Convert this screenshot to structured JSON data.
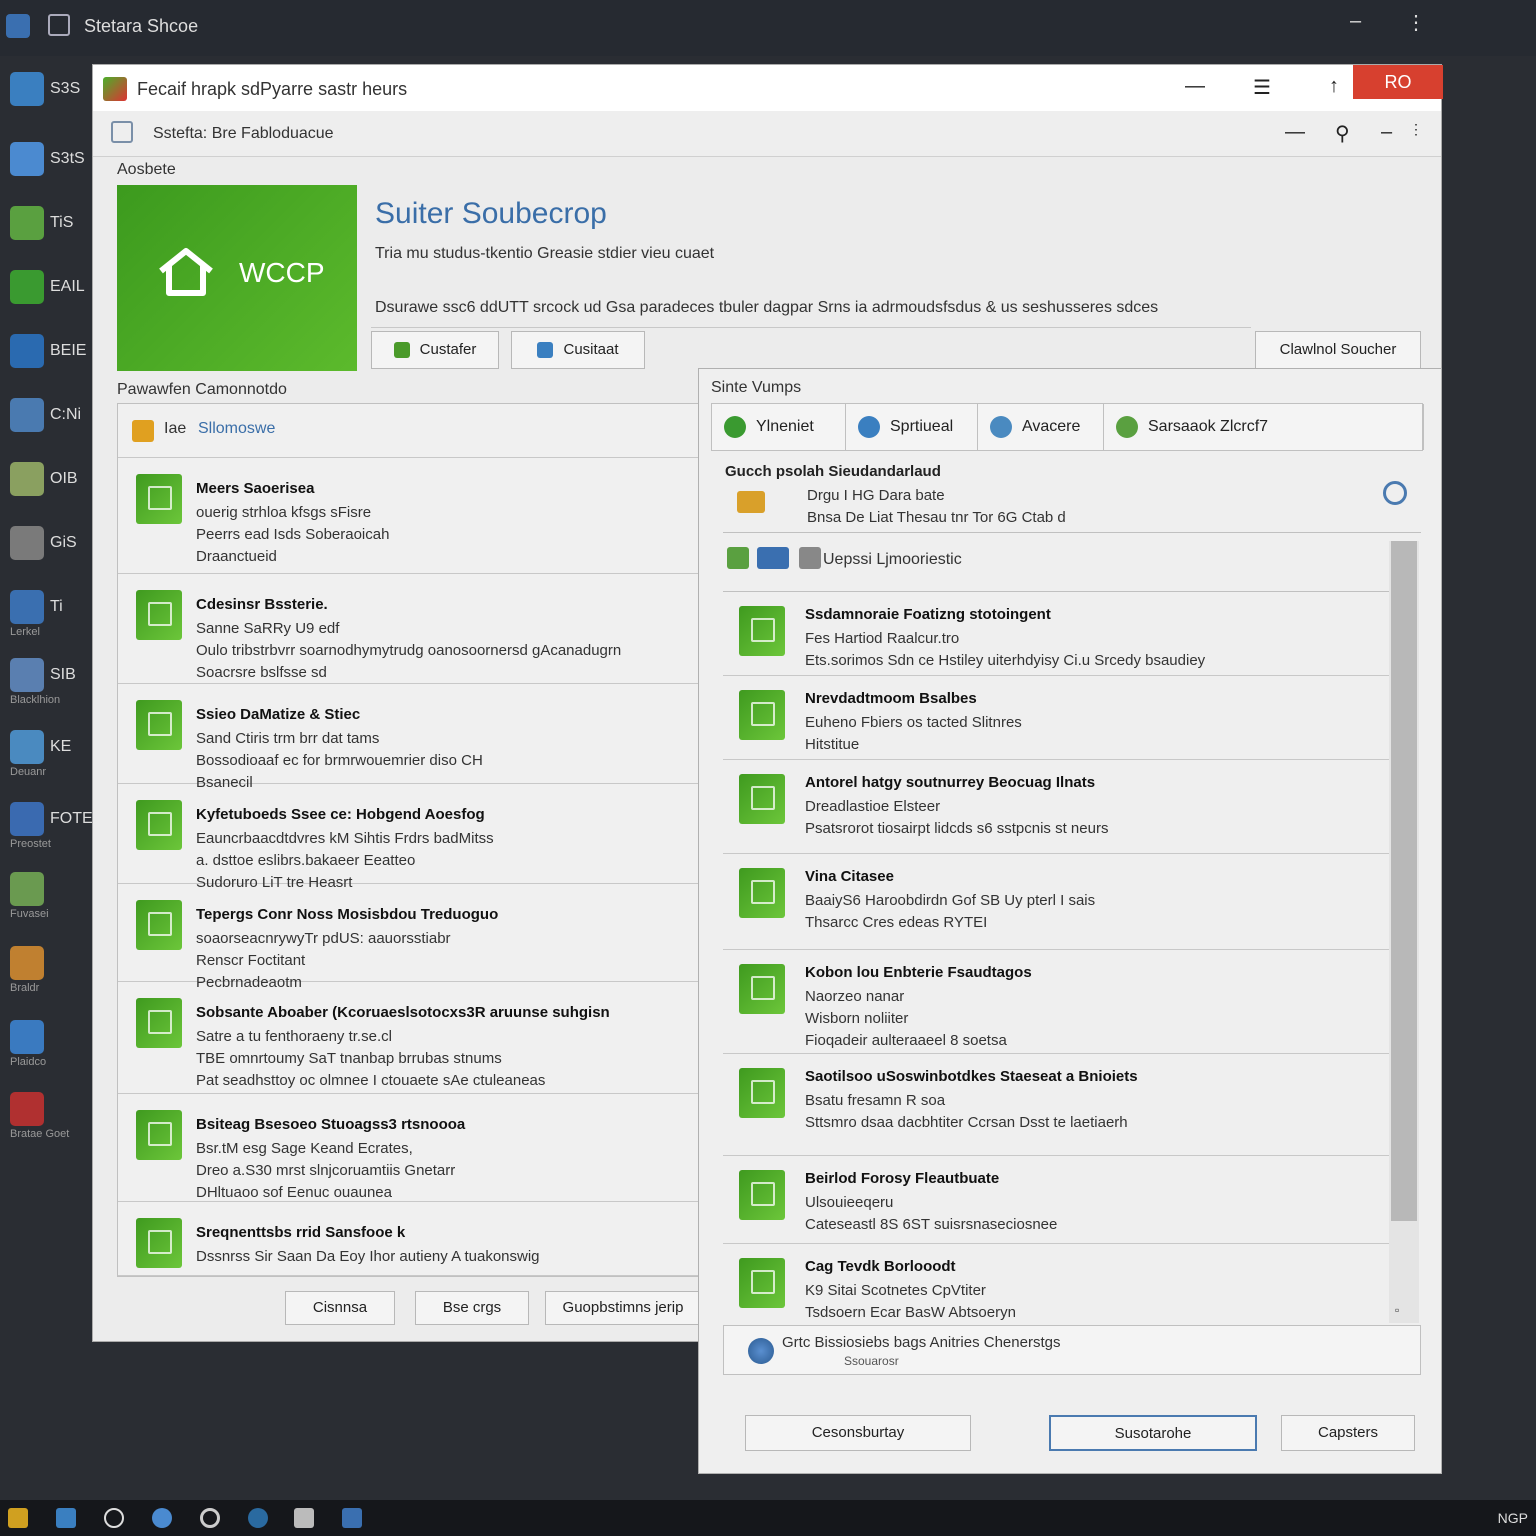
{
  "desktop": {
    "topbar_title": "Stetara Shcoe",
    "icons": [
      {
        "label": "S3S",
        "sub": "",
        "color": "#3a7fc0"
      },
      {
        "label": "S3tS",
        "sub": "",
        "color": "#4b8ad0"
      },
      {
        "label": "TiS",
        "sub": "",
        "color": "#5aa040"
      },
      {
        "label": "EAIL",
        "sub": "",
        "color": "#3a9a30"
      },
      {
        "label": "BEIE",
        "sub": "",
        "color": "#2a6ab0"
      },
      {
        "label": "C:Ni",
        "sub": "",
        "color": "#4a7ab0"
      },
      {
        "label": "OIB",
        "sub": "",
        "color": "#8aa060"
      },
      {
        "label": "GiS",
        "sub": "",
        "color": "#7a7a7a"
      },
      {
        "label": "Ti",
        "sub": "Lerkel",
        "color": "#3a6fb0"
      },
      {
        "label": "SIB",
        "sub": "Blacklhion",
        "color": "#5a7fb0"
      },
      {
        "label": "KE",
        "sub": "Deuanr",
        "color": "#4a8ac0"
      },
      {
        "label": "FOTE",
        "sub": "Preostet",
        "color": "#3a6ab0"
      },
      {
        "label": "",
        "sub": "Fuvasei",
        "color": "#6a9a50"
      },
      {
        "label": "",
        "sub": "Braldr",
        "color": "#c08030"
      },
      {
        "label": "",
        "sub": "Plaidco",
        "color": "#3a7ac0"
      },
      {
        "label": "",
        "sub": "Bratae Goet",
        "color": "#b03030"
      }
    ],
    "taskbar_tray": "NGP"
  },
  "main_window": {
    "title": "Fecaif hrapk sdPyarre sastr heurs",
    "close_label": "RO",
    "subbar_text": "Sstefta: Bre Fabloduacue",
    "section_about": "Aosbete",
    "banner_text": "WCCP",
    "hero_title": "Suiter Soubecrop",
    "hero_subtitle": "Tria mu studus-tkentio Greasie stdier vieu cuaet",
    "hero_desc": "Dsurawe ssc6 ddUTT srcock ud Gsa paradeces tbuler dagpar Srns ia adrmoudsfsdus & us seshusseres sdces",
    "btn_customize": "Custafer",
    "btn_config": "Cusitaat",
    "btn_download": "Clawlnol Soucher",
    "section_packages": "Pawawfen Camonnotdo",
    "list_header_a": "Iae",
    "list_header_b": "Sllomoswe",
    "left_items": [
      {
        "title": "Meers Saoerisea",
        "lines": [
          "ouerig strhloa kfsgs sFisre",
          "Peerrs ead Isds Soberaoicah",
          "Draanctueid"
        ]
      },
      {
        "title": "Cdesinsr Bssterie.",
        "lines": [
          "Sanne SaRRy U9 edf",
          "Oulo tribstrbvrr soarnodhymytrudg oanosoornersd gAcanadugrn",
          "Soacrsre bslfsse sd"
        ]
      },
      {
        "title": "Ssieo DaMatize & Stiec",
        "lines": [
          "Sand Ctiris trm brr dat tams",
          "Bossodioaaf ec for brmrwouemrier diso CH",
          "Bsanecil"
        ]
      },
      {
        "title": "Kyfetuboeds Ssee ce: Hobgend Aoesfog",
        "lines": [
          "Eauncrbaacdtdvres kM Sihtis Frdrs badMitss",
          "a. dsttoe eslibrs.bakaeer Eeatteo",
          "Sudoruro LiT tre Heasrt"
        ]
      },
      {
        "title": "Tepergs Conr Noss Mosisbdou Treduoguo",
        "lines": [
          "soaorseacnrywyTr pdUS: aauorsstiabr",
          "Renscr Foctitant",
          "Pecbrnadeaotm"
        ]
      },
      {
        "title": "Sobsante Aboaber (Kcoruaeslsotocxs3R aruunse suhgisn",
        "lines": [
          "Satre a tu fenthoraeny tr.se.cl",
          "TBE omnrtoumy SaT tnanbap brrubas stnums",
          "Pat seadhsttoy oc olmnee I ctouaete sAe ctuleaneas"
        ]
      },
      {
        "title": "Bsiteag Bsesoeo Stuoagss3 rtsnoooa",
        "lines": [
          "Bsr.tM esg Sage Keand Ecrates,",
          "Dreo a.S30 mrst slnjcoruamtiis Gnetarr",
          "DHltuaoo sof Eenuc ouaunea"
        ]
      },
      {
        "title": "Sreqnenttsbs rrid Sansfooe k",
        "lines": [
          "Dssnrss Sir Saan Da Eoy Ihor autieny A tuakonswig"
        ]
      }
    ],
    "footer_buttons": [
      "Cisnnsa",
      "Bse crgs",
      "Guopbstimns jerip"
    ]
  },
  "dialog": {
    "title": "Sinte Vumps",
    "tabs": [
      {
        "label": "Ylneniet",
        "color": "#3a9a30"
      },
      {
        "label": "Sprtiueal",
        "color": "#3a7fc0"
      },
      {
        "label": "Avacere",
        "color": "#4a8ac0"
      },
      {
        "label": "Sarsaaok Zlcrcf7",
        "color": "#5aa040"
      }
    ],
    "info_title": "Gucch psolah Sieudandarlaud",
    "info_line1": "Drgu I HG Dara bate",
    "info_line2": "Bnsa De Liat Thesau tnr Tor  6G  Ctab d",
    "filter_text": "Uepssi Ljmooriestic",
    "items": [
      {
        "title": "Ssdamnoraie Foatizng stotoingent",
        "lines": [
          "Fes Hartiod Raalcur.tro",
          "Ets.sorimos Sdn ce Hstiley uiterhdyisy Ci.u Srcedy bsaudiey"
        ]
      },
      {
        "title": "Nrevdadtmoom Bsalbes",
        "lines": [
          "Euheno Fbiers os tacted Slitnres",
          "Hitstitue"
        ]
      },
      {
        "title": "Antorel hatgy soutnurrey Beocuag Ilnats",
        "lines": [
          "Dreadlastioe Elsteer",
          "Psatsrorot tiosairpt lidcds s6 sstpcnis st neurs"
        ]
      },
      {
        "title": "Vina Citasee",
        "lines": [
          "BaaiyS6 Haroobdirdn Gof SB Uy pterl I sais",
          "Thsarcc Cres edeas RYTEI"
        ]
      },
      {
        "title": "Kobon lou Enbterie Fsaudtagos",
        "lines": [
          "Naorzeo nanar",
          "Wisborn noliiter",
          "Fioqadeir aulteraaeel 8 soetsa"
        ]
      },
      {
        "title": "Saotilsoo uSoswinbotdkes Staeseat a Bnioiets",
        "lines": [
          "Bsatu fresamn R soa",
          "Sttsmro dsaa dacbhtiter Ccrsan Dsst te laetiaerh"
        ]
      },
      {
        "title": "Beirlod Forosy Fleautbuate",
        "lines": [
          "Ulsouieeqeru",
          "Cateseastl 8S 6ST suisrsnaseciosnee"
        ]
      },
      {
        "title": "Cag Tevdk Borlooodt",
        "lines": [
          "K9 Sitai Scotnetes CpVtiter",
          "Tsdsoern Ecar BasW Abtsoeryn"
        ]
      }
    ],
    "status_line1": "Grtc Bissiosiebs bags Anitries Chenerstgs",
    "status_line2": "Ssouarosr",
    "footer_buttons": [
      "Cesonsburtay",
      "Susotarohe",
      "Capsters"
    ]
  }
}
